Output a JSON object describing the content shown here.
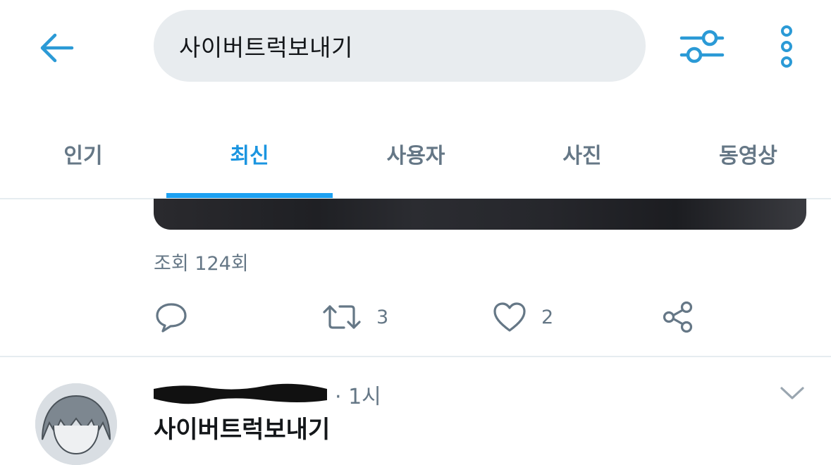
{
  "search": {
    "query": "사이버트럭보내기"
  },
  "tabs": [
    {
      "label": "인기",
      "active": false
    },
    {
      "label": "최신",
      "active": true
    },
    {
      "label": "사용자",
      "active": false
    },
    {
      "label": "사진",
      "active": false
    },
    {
      "label": "동영상",
      "active": false
    }
  ],
  "tweet": {
    "views": "조회 124회",
    "retweet_count": "3",
    "like_count": "2"
  },
  "next_tweet": {
    "time": "· 1시",
    "text": "사이버트럭보내기"
  },
  "colors": {
    "accent": "#1da1f2",
    "icon": "#2b9ad6",
    "muted": "#657786",
    "search_bg": "#e8ecef"
  },
  "icons": {
    "back": "arrow-left-icon",
    "filter": "sliders-icon",
    "more": "vertical-dots-icon",
    "reply": "speech-bubble-icon",
    "retweet": "retweet-icon",
    "like": "heart-icon",
    "share": "share-icon",
    "caret": "chevron-down-icon"
  }
}
